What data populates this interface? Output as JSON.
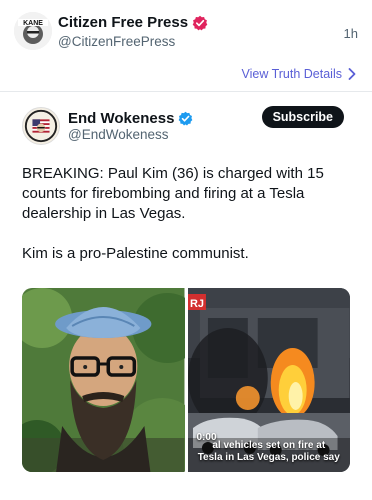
{
  "post": {
    "author_name": "Citizen Free Press",
    "author_handle": "@CitizenFreePress",
    "timestamp": "1h",
    "avatar_label": "KANE",
    "verified_badge_icon": "verified-pink-badge-icon",
    "verified_badge_color": "#e0245e"
  },
  "truth_link": {
    "label": "View Truth Details",
    "icon": "chevron-right-icon",
    "color": "#5a5fd6"
  },
  "quoted": {
    "author_name": "End Wokeness",
    "author_handle": "@EndWokeness",
    "verified_badge_icon": "verified-blue-badge-icon",
    "verified_badge_color": "#1d9bf0",
    "subscribe_label": "Subscribe",
    "text_paragraphs": [
      "BREAKING: Paul Kim (36) is charged with 15 counts for firebombing and firing at a Tesla dealership in Las Vegas.",
      "Kim is a pro-Palestine communist."
    ],
    "media": {
      "video_duration": "0:00",
      "video_caption_line1": "al vehicles set on fire at",
      "video_caption_line2": "Tesla in Las Vegas, police say",
      "video_logo": "RJ"
    }
  }
}
